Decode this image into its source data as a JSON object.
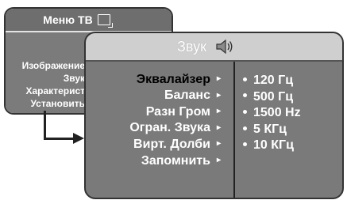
{
  "tv_menu": {
    "title": "Меню ТВ",
    "items": [
      "Изображение",
      "Звук",
      "Характерист",
      "Установить"
    ]
  },
  "sound_menu": {
    "title": "Звук",
    "items": [
      {
        "label": "Эквалайзер",
        "active": true
      },
      {
        "label": "Баланс"
      },
      {
        "label": "Разн Гром"
      },
      {
        "label": "Огран. Звука"
      },
      {
        "label": "Вирт. Долби"
      },
      {
        "label": "Запомнить"
      }
    ],
    "arrow": "▸",
    "bands": [
      "120 Гц",
      "500 Гц",
      "1500 Hz",
      "5 КГц",
      "10 КГц"
    ]
  }
}
